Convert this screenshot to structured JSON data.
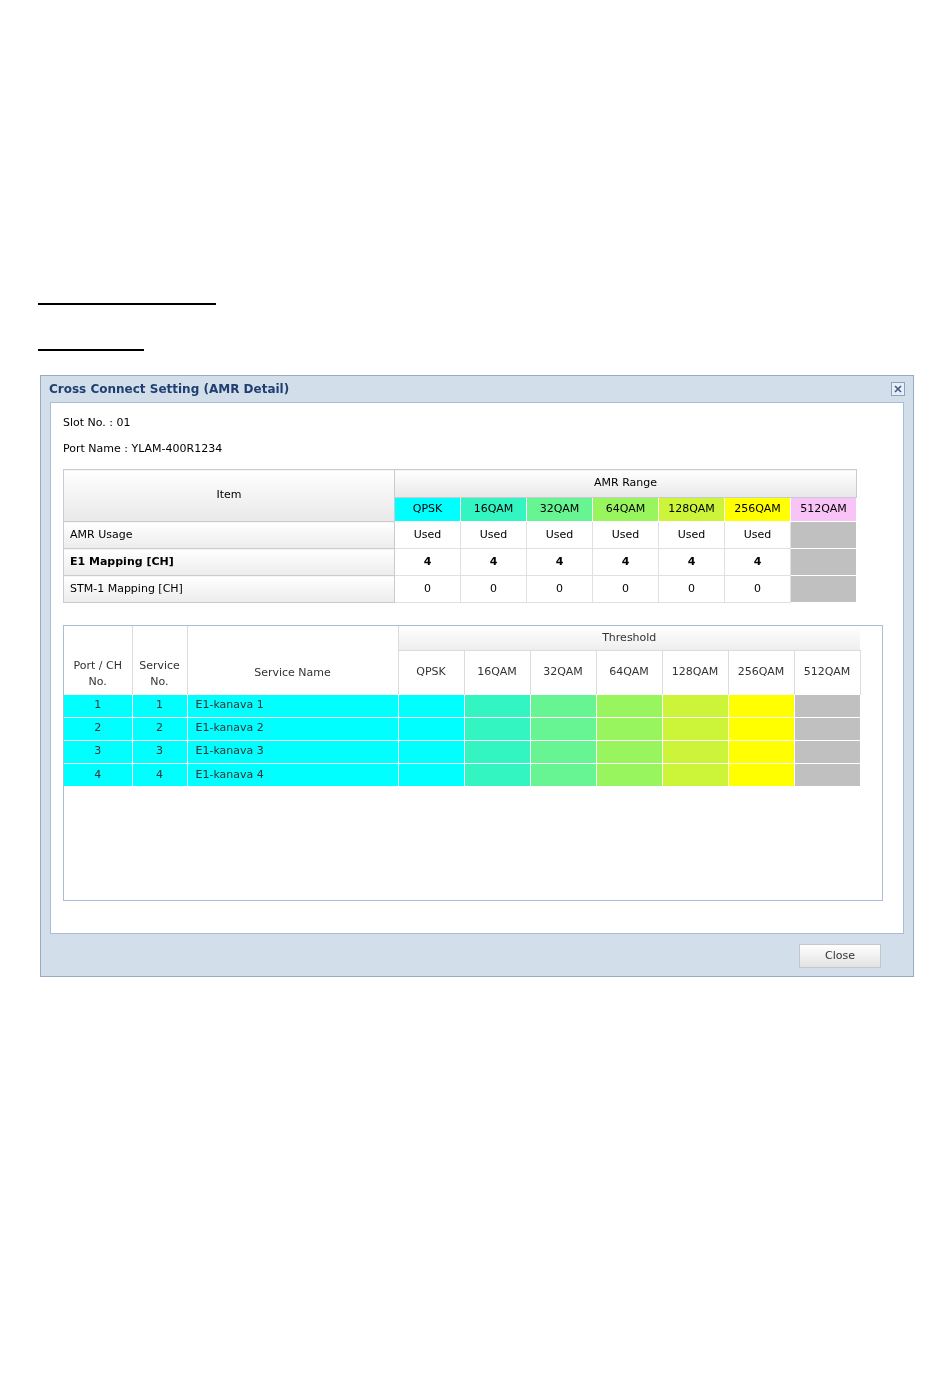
{
  "dialog": {
    "title": "Cross Connect Setting (AMR Detail)",
    "close_button": "Close"
  },
  "slot": "Slot No. : 01",
  "port_name": "Port Name : YLAM-400R1234",
  "amr_table": {
    "item_header": "Item",
    "range_header": "AMR Range",
    "modulations": [
      {
        "label": "QPSK",
        "color": "#00ffff",
        "used": true
      },
      {
        "label": "16QAM",
        "color": "#33f5c2",
        "used": true
      },
      {
        "label": "32QAM",
        "color": "#66f592",
        "used": true
      },
      {
        "label": "64QAM",
        "color": "#99f55e",
        "used": true
      },
      {
        "label": "128QAM",
        "color": "#ccf53a",
        "used": true
      },
      {
        "label": "256QAM",
        "color": "#ffff00",
        "used": true
      },
      {
        "label": "512QAM",
        "color": "#f8c4f8",
        "used": false
      }
    ],
    "rows": [
      {
        "label": "AMR Usage",
        "bold": false,
        "values": [
          "Used",
          "Used",
          "Used",
          "Used",
          "Used",
          "Used"
        ]
      },
      {
        "label": "E1 Mapping [CH]",
        "bold": true,
        "values": [
          "4",
          "4",
          "4",
          "4",
          "4",
          "4"
        ]
      },
      {
        "label": "STM-1 Mapping [CH]",
        "bold": false,
        "values": [
          "0",
          "0",
          "0",
          "0",
          "0",
          "0"
        ]
      }
    ]
  },
  "service_table": {
    "port_header": "Port / CH No.",
    "service_header": "Service No.",
    "name_header": "Service Name",
    "threshold_header": "Threshold",
    "threshold_columns": [
      "QPSK",
      "16QAM",
      "32QAM",
      "64QAM",
      "128QAM",
      "256QAM",
      "512QAM"
    ],
    "rows": [
      {
        "port": "1",
        "service": "1",
        "name": "E1-kanava 1"
      },
      {
        "port": "2",
        "service": "2",
        "name": "E1-kanava 2"
      },
      {
        "port": "3",
        "service": "3",
        "name": "E1-kanava 3"
      },
      {
        "port": "4",
        "service": "4",
        "name": "E1-kanava 4"
      }
    ]
  }
}
